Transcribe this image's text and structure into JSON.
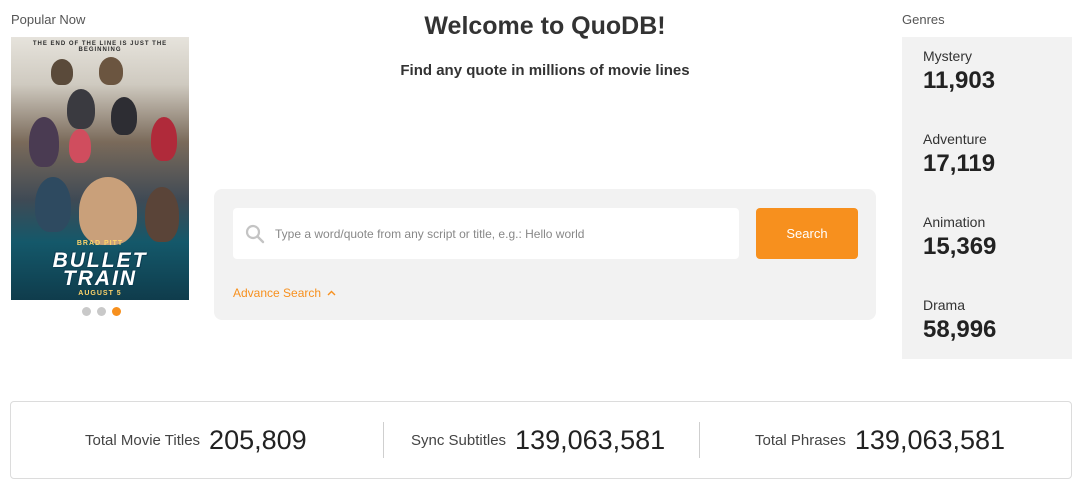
{
  "popular": {
    "title": "Popular Now",
    "poster": {
      "tagline": "THE END OF THE LINE IS JUST THE BEGINNING",
      "actor": "BRAD PITT",
      "title_line1": "BULLET",
      "title_line2": "TRAIN",
      "release": "AUGUST 5"
    },
    "carousel_dots": 3,
    "active_dot": 2
  },
  "header": {
    "title": "Welcome to QuoDB!",
    "subtitle": "Find any quote in millions of movie lines"
  },
  "search": {
    "placeholder": "Type a word/quote from any script or title, e.g.: Hello world",
    "value": "",
    "button_label": "Search",
    "advanced_label": "Advance Search"
  },
  "genres": {
    "title": "Genres",
    "items": [
      {
        "name": "Mystery",
        "count": "11,903"
      },
      {
        "name": "Adventure",
        "count": "17,119"
      },
      {
        "name": "Animation",
        "count": "15,369"
      },
      {
        "name": "Drama",
        "count": "58,996"
      }
    ]
  },
  "stats": [
    {
      "label": "Total Movie Titles",
      "value": "205,809"
    },
    {
      "label": "Sync Subtitles",
      "value": "139,063,581"
    },
    {
      "label": "Total Phrases",
      "value": "139,063,581"
    }
  ],
  "colors": {
    "accent": "#f7901e",
    "panel": "#f2f2f2",
    "dot_inactive": "#c9c9c9"
  }
}
